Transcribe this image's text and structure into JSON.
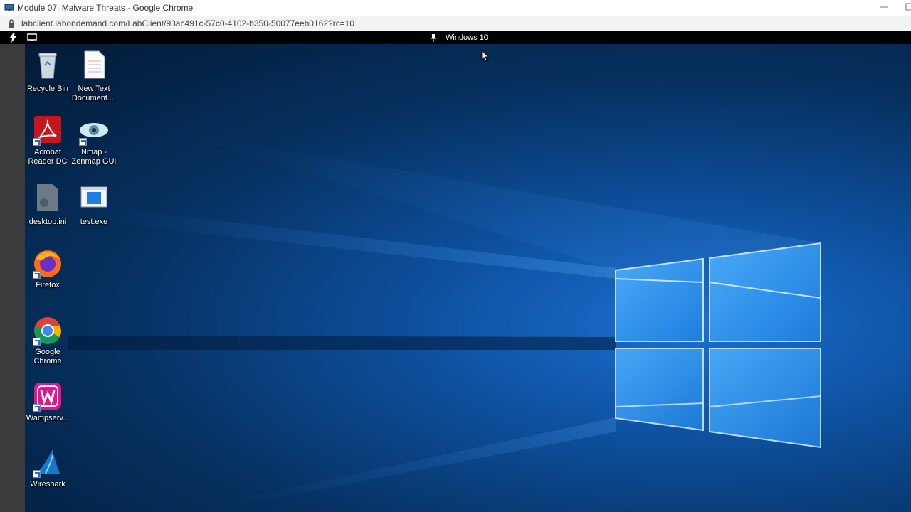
{
  "window": {
    "title": "Module 07: Malware Threats - Google Chrome",
    "url": "labclient.labondemand.com/LabClient/93ac491c-57c0-4102-b350-50077eeb0162?rc=10"
  },
  "lab_toolbar": {
    "vm_name": "Windows 10"
  },
  "desktop_icons": [
    {
      "label": "Recycle Bin",
      "icon": "recycle-bin-icon"
    },
    {
      "label": "New Text Document....",
      "icon": "text-document-icon"
    },
    {
      "label": "Acrobat Reader DC",
      "icon": "acrobat-reader-icon"
    },
    {
      "label": "Nmap - Zenmap GUI",
      "icon": "nmap-zenmap-icon"
    },
    {
      "label": "desktop.ini",
      "icon": "ini-file-icon"
    },
    {
      "label": "test.exe",
      "icon": "exe-file-icon"
    },
    {
      "label": "Firefox",
      "icon": "firefox-icon"
    },
    {
      "label": "Google Chrome",
      "icon": "chrome-icon"
    },
    {
      "label": "Wampserv...",
      "icon": "wampserver-icon"
    },
    {
      "label": "Wireshark",
      "icon": "wireshark-icon"
    }
  ],
  "colors": {
    "desktop_blue": "#0d4f9c",
    "toolbar_black": "#000000",
    "side_strip": "#3b3b3b"
  }
}
